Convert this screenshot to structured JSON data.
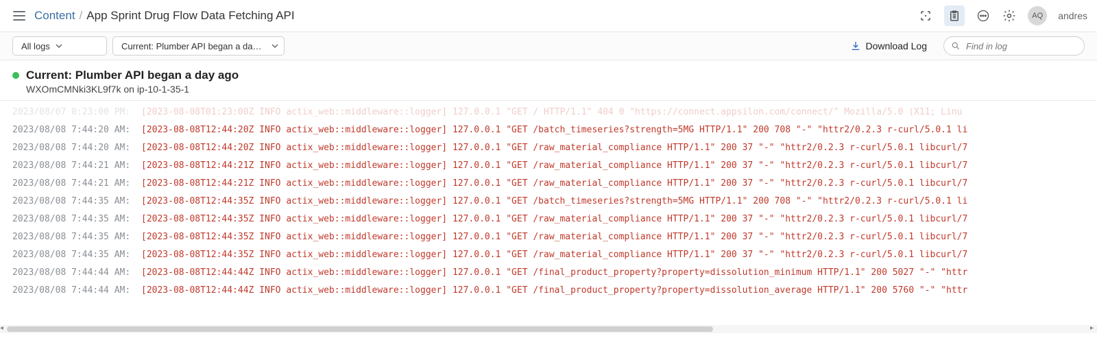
{
  "breadcrumb": {
    "link": "Content",
    "current": "App Sprint Drug Flow Data Fetching API"
  },
  "user": {
    "initials": "AQ",
    "name": "andres"
  },
  "toolbar": {
    "logs_filter": "All logs",
    "job_filter": "Current: Plumber API began a day …",
    "download": "Download Log",
    "search_placeholder": "Find in log"
  },
  "session": {
    "title": "Current: Plumber API began a day ago",
    "proc": "WXOmCMNki3KL9f7k on ip-10-1-35-1"
  },
  "logs": [
    {
      "ts": "2023/08/07 0:23:00 PM:",
      "faded": true,
      "msg": "[2023-08-08T01:23:00Z INFO actix_web::middleware::logger] 127.0.0.1 \"GET / HTTP/1.1\" 404 0 \"https://connect.appsilon.com/connect/\"  Mozilla/5.0 (X11; Linu"
    },
    {
      "ts": "2023/08/08 7:44:20 AM:",
      "msg": "[2023-08-08T12:44:20Z INFO actix_web::middleware::logger] 127.0.0.1 \"GET /batch_timeseries?strength=5MG HTTP/1.1\" 200 708 \"-\" \"httr2/0.2.3 r-curl/5.0.1 li"
    },
    {
      "ts": "2023/08/08 7:44:20 AM:",
      "msg": "[2023-08-08T12:44:20Z INFO actix_web::middleware::logger] 127.0.0.1 \"GET /raw_material_compliance HTTP/1.1\" 200 37 \"-\" \"httr2/0.2.3 r-curl/5.0.1 libcurl/7"
    },
    {
      "ts": "2023/08/08 7:44:21 AM:",
      "msg": "[2023-08-08T12:44:21Z INFO actix_web::middleware::logger] 127.0.0.1 \"GET /raw_material_compliance HTTP/1.1\" 200 37 \"-\" \"httr2/0.2.3 r-curl/5.0.1 libcurl/7"
    },
    {
      "ts": "2023/08/08 7:44:21 AM:",
      "msg": "[2023-08-08T12:44:21Z INFO actix_web::middleware::logger] 127.0.0.1 \"GET /raw_material_compliance HTTP/1.1\" 200 37 \"-\" \"httr2/0.2.3 r-curl/5.0.1 libcurl/7"
    },
    {
      "ts": "2023/08/08 7:44:35 AM:",
      "msg": "[2023-08-08T12:44:35Z INFO actix_web::middleware::logger] 127.0.0.1 \"GET /batch_timeseries?strength=5MG HTTP/1.1\" 200 708 \"-\" \"httr2/0.2.3 r-curl/5.0.1 li"
    },
    {
      "ts": "2023/08/08 7:44:35 AM:",
      "msg": "[2023-08-08T12:44:35Z INFO actix_web::middleware::logger] 127.0.0.1 \"GET /raw_material_compliance HTTP/1.1\" 200 37 \"-\" \"httr2/0.2.3 r-curl/5.0.1 libcurl/7"
    },
    {
      "ts": "2023/08/08 7:44:35 AM:",
      "msg": "[2023-08-08T12:44:35Z INFO actix_web::middleware::logger] 127.0.0.1 \"GET /raw_material_compliance HTTP/1.1\" 200 37 \"-\" \"httr2/0.2.3 r-curl/5.0.1 libcurl/7"
    },
    {
      "ts": "2023/08/08 7:44:35 AM:",
      "msg": "[2023-08-08T12:44:35Z INFO actix_web::middleware::logger] 127.0.0.1 \"GET /raw_material_compliance HTTP/1.1\" 200 37 \"-\" \"httr2/0.2.3 r-curl/5.0.1 libcurl/7"
    },
    {
      "ts": "2023/08/08 7:44:44 AM:",
      "msg": "[2023-08-08T12:44:44Z INFO actix_web::middleware::logger] 127.0.0.1 \"GET /final_product_property?property=dissolution_minimum HTTP/1.1\" 200 5027 \"-\" \"httr"
    },
    {
      "ts": "2023/08/08 7:44:44 AM:",
      "msg": "[2023-08-08T12:44:44Z INFO actix_web::middleware::logger] 127.0.0.1 \"GET /final_product_property?property=dissolution_average HTTP/1.1\" 200 5760 \"-\" \"httr"
    }
  ]
}
